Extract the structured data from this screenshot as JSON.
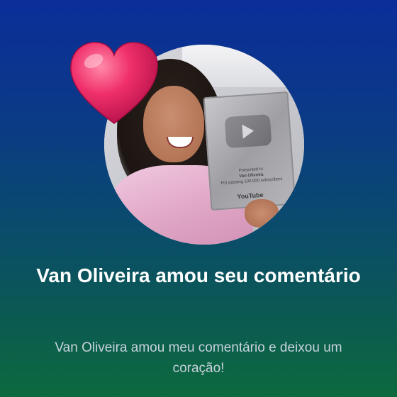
{
  "notification": {
    "title": "Van Oliveira amou seu comentário",
    "message": "Van Oliveira amou meu comentário e deixou um coração!"
  },
  "avatar": {
    "description_icon": "heart-icon",
    "plaque": {
      "line1": "Presented to",
      "line2": "Van Oliveira",
      "line3": "For passing 100,000 subscribers",
      "brand": "YouTube"
    }
  },
  "colors": {
    "background_top": "#0b2e99",
    "background_bottom": "#0c6a3d",
    "heart": "#f0306a",
    "title": "#ffffff",
    "subtitle": "#c8d2dc"
  }
}
